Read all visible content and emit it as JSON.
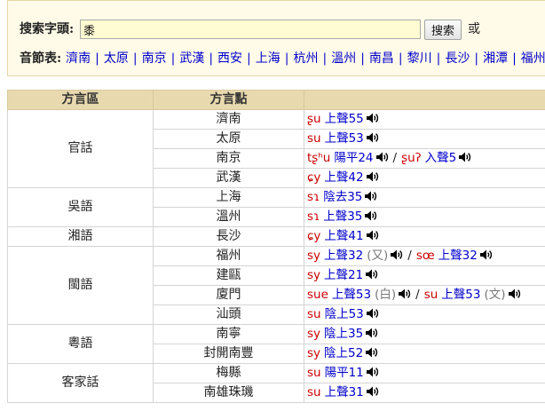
{
  "search": {
    "label": "搜索字頭:",
    "value": "黍",
    "button_label": "搜索",
    "or_text": "或"
  },
  "syllabary": {
    "label": "音節表:",
    "separator": "|",
    "links": [
      "濟南",
      "太原",
      "南京",
      "武漢",
      "西安",
      "上海",
      "杭州",
      "溫州",
      "南昌",
      "黎川",
      "長沙",
      "湘潭",
      "福州"
    ]
  },
  "table": {
    "headers": [
      "方言區",
      "方言點"
    ],
    "reading_separator": "/",
    "groups": [
      {
        "region": "官話",
        "rows": [
          {
            "location": "濟南",
            "readings": [
              {
                "ipa": "ʂu",
                "tone": "上聲55"
              }
            ]
          },
          {
            "location": "太原",
            "readings": [
              {
                "ipa": "su",
                "tone": "上聲53"
              }
            ]
          },
          {
            "location": "南京",
            "readings": [
              {
                "ipa": "tʂʰu",
                "tone": "陽平24"
              },
              {
                "ipa": "ʂuʔ",
                "tone": "入聲5"
              }
            ]
          },
          {
            "location": "武漢",
            "readings": [
              {
                "ipa": "ɕy",
                "tone": "上聲42"
              }
            ]
          }
        ]
      },
      {
        "region": "吳語",
        "rows": [
          {
            "location": "上海",
            "readings": [
              {
                "ipa": "sɿ",
                "tone": "陰去35"
              }
            ]
          },
          {
            "location": "溫州",
            "readings": [
              {
                "ipa": "sɿ",
                "tone": "上聲35"
              }
            ]
          }
        ]
      },
      {
        "region": "湘語",
        "rows": [
          {
            "location": "長沙",
            "readings": [
              {
                "ipa": "ɕy",
                "tone": "上聲41"
              }
            ]
          }
        ]
      },
      {
        "region": "閩語",
        "rows": [
          {
            "location": "福州",
            "readings": [
              {
                "ipa": "sy",
                "tone": "上聲32",
                "note": "(又)"
              },
              {
                "ipa": "sœ",
                "tone": "上聲32"
              }
            ]
          },
          {
            "location": "建甌",
            "readings": [
              {
                "ipa": "sy",
                "tone": "上聲21"
              }
            ]
          },
          {
            "location": "廈門",
            "readings": [
              {
                "ipa": "sue",
                "tone": "上聲53",
                "note": "(白)"
              },
              {
                "ipa": "su",
                "tone": "上聲53",
                "note": "(文)"
              }
            ]
          },
          {
            "location": "汕頭",
            "readings": [
              {
                "ipa": "su",
                "tone": "陰上53"
              }
            ]
          }
        ]
      },
      {
        "region": "粵語",
        "rows": [
          {
            "location": "南寧",
            "readings": [
              {
                "ipa": "sy",
                "tone": "陰上35"
              }
            ]
          },
          {
            "location": "封開南豐",
            "readings": [
              {
                "ipa": "sy",
                "tone": "陰上52"
              }
            ]
          }
        ]
      },
      {
        "region": "客家話",
        "rows": [
          {
            "location": "梅縣",
            "readings": [
              {
                "ipa": "su",
                "tone": "陽平11"
              }
            ]
          },
          {
            "location": "南雄珠璣",
            "readings": [
              {
                "ipa": "su",
                "tone": "上聲31"
              }
            ]
          }
        ]
      }
    ]
  },
  "icons": {
    "audio": "speaker-icon"
  },
  "colors": {
    "ipa_text": "#cc0000",
    "tone_link": "#0000cc",
    "link": "#0000cc",
    "note_text": "#777777",
    "header_bg": "#e8d9ae",
    "panel_bg": "#fffbe8",
    "input_bg": "#fffbd2"
  }
}
